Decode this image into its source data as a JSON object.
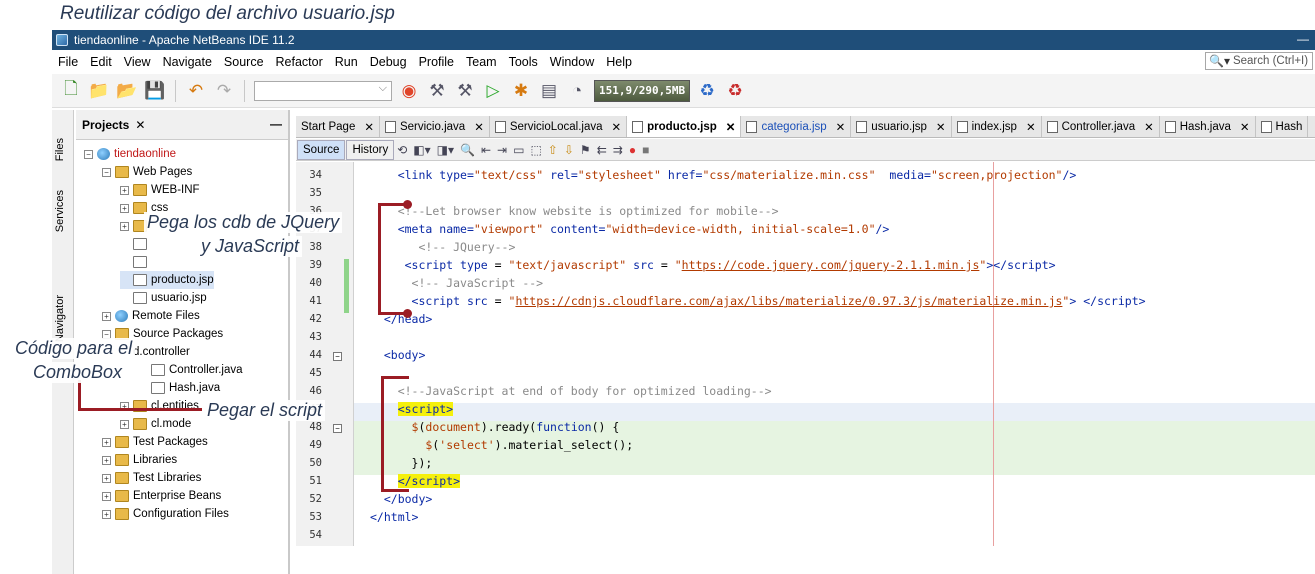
{
  "caption": "Reutilizar código del archivo usuario.jsp",
  "window": {
    "title": "tiendaonline - Apache NetBeans IDE 11.2"
  },
  "menu": [
    "File",
    "Edit",
    "View",
    "Navigate",
    "Source",
    "Refactor",
    "Run",
    "Debug",
    "Profile",
    "Team",
    "Tools",
    "Window",
    "Help"
  ],
  "search": {
    "placeholder": "Search (Ctrl+I)"
  },
  "toolbar": {
    "memory": "151,9/290,5MB"
  },
  "side_tabs": [
    "Files",
    "Services",
    "Navigator"
  ],
  "projects": {
    "title": "Projects",
    "tree": [
      {
        "label": "tiendaonline",
        "level": 0,
        "toggle": "−",
        "icon": "globe",
        "red": true
      },
      {
        "label": "Web Pages",
        "level": 1,
        "toggle": "−",
        "icon": "folder"
      },
      {
        "label": "WEB-INF",
        "level": 2,
        "toggle": "+",
        "icon": "folder"
      },
      {
        "label": "css",
        "level": 2,
        "toggle": "+",
        "icon": "folder"
      },
      {
        "label": "",
        "level": 2,
        "toggle": "+",
        "icon": "folder"
      },
      {
        "label": "",
        "level": 2,
        "toggle": "",
        "icon": "file"
      },
      {
        "label": "",
        "level": 2,
        "toggle": "",
        "icon": "file"
      },
      {
        "label": "producto.jsp",
        "level": 2,
        "toggle": "",
        "icon": "file",
        "selected": true
      },
      {
        "label": "usuario.jsp",
        "level": 2,
        "toggle": "",
        "icon": "file"
      },
      {
        "label": "Remote Files",
        "level": 1,
        "toggle": "+",
        "icon": "globe"
      },
      {
        "label": "Source Packages",
        "level": 1,
        "toggle": "−",
        "icon": "folder"
      },
      {
        "label": "d.controller",
        "level": 2,
        "toggle": "",
        "icon": ""
      },
      {
        "label": "Controller.java",
        "level": 3,
        "toggle": "",
        "icon": "file"
      },
      {
        "label": "Hash.java",
        "level": 3,
        "toggle": "",
        "icon": "file"
      },
      {
        "label": "cl.entities",
        "level": 2,
        "toggle": "+",
        "icon": "folder"
      },
      {
        "label": "cl.mode",
        "level": 2,
        "toggle": "+",
        "icon": "folder"
      },
      {
        "label": "Test Packages",
        "level": 1,
        "toggle": "+",
        "icon": "folder"
      },
      {
        "label": "Libraries",
        "level": 1,
        "toggle": "+",
        "icon": "folder"
      },
      {
        "label": "Test Libraries",
        "level": 1,
        "toggle": "+",
        "icon": "folder"
      },
      {
        "label": "Enterprise Beans",
        "level": 1,
        "toggle": "+",
        "icon": "folder"
      },
      {
        "label": "Configuration Files",
        "level": 1,
        "toggle": "+",
        "icon": "folder"
      }
    ]
  },
  "editor_tabs": [
    {
      "label": "Start Page",
      "icon": false
    },
    {
      "label": "Servicio.java",
      "icon": true
    },
    {
      "label": "ServicioLocal.java",
      "icon": true
    },
    {
      "label": "producto.jsp",
      "icon": true,
      "active": true
    },
    {
      "label": "categoria.jsp",
      "icon": true,
      "blue": true
    },
    {
      "label": "usuario.jsp",
      "icon": true
    },
    {
      "label": "index.jsp",
      "icon": true
    },
    {
      "label": "Controller.java",
      "icon": true
    },
    {
      "label": "Hash.java",
      "icon": true
    },
    {
      "label": "Hash",
      "icon": true,
      "noclose": true
    }
  ],
  "editor_toolbar": {
    "source": "Source",
    "history": "History"
  },
  "code_lines": [
    {
      "n": "34",
      "html": "    <span class='tag'>&lt;link</span> <span class='attr'>type=</span><span class='str'>\"text/css\"</span> <span class='attr'>rel=</span><span class='str'>\"stylesheet\"</span> <span class='attr'>href=</span><span class='str'>\"css/materialize.min.css\"</span>  <span class='attr'>media=</span><span class='str'>\"screen,projection\"</span><span class='tag'>/&gt;</span>"
    },
    {
      "n": "35",
      "html": ""
    },
    {
      "n": "36",
      "html": "    <span class='cmt'>&lt;!--Let browser know website is optimized for mobile--&gt;</span>"
    },
    {
      "n": "37",
      "html": "    <span class='tag'>&lt;meta</span> <span class='attr'>name=</span><span class='str'>\"viewport\"</span> <span class='attr'>content=</span><span class='str'>\"width=device-width, initial-scale=1.0\"</span><span class='tag'>/&gt;</span>"
    },
    {
      "n": "38",
      "html": "       <span class='cmt'>&lt;!-- JQuery--&gt;</span>"
    },
    {
      "n": "39",
      "html": "     <span class='tag'>&lt;script</span> <span class='attr'>type</span> = <span class='str'>\"text/javascript\"</span> <span class='attr'>src</span> = <span class='str'>\"<span class='url'>https://code.jquery.com/jquery-2.1.1.min.js</span>\"</span><span class='tag'>&gt;&lt;/script&gt;</span>"
    },
    {
      "n": "40",
      "html": "      <span class='cmt'>&lt;!-- JavaScript --&gt;</span>"
    },
    {
      "n": "41",
      "html": "      <span class='tag'>&lt;script</span> <span class='attr'>src</span> = <span class='str'>\"<span class='url'>https://cdnjs.cloudflare.com/ajax/libs/materialize/0.97.3/js/materialize.min.js</span>\"</span><span class='tag'>&gt;</span> <span class='tag'>&lt;/script&gt;</span>"
    },
    {
      "n": "42",
      "html": "  <span class='tag'>&lt;/head&gt;</span>"
    },
    {
      "n": "43",
      "html": ""
    },
    {
      "n": "44",
      "html": "  <span class='tag'>&lt;body&gt;</span>"
    },
    {
      "n": "45",
      "html": ""
    },
    {
      "n": "46",
      "html": "    <span class='cmt'>&lt;!--JavaScript at end of body for optimized loading--&gt;</span>"
    },
    {
      "n": "47",
      "html": "    <span class='tag yel'>&lt;script&gt;</span>"
    },
    {
      "n": "48",
      "html": "      <span class='str'>$</span>(<span class='str'>document</span>).ready(<span class='kw'>function</span>() {"
    },
    {
      "n": "49",
      "html": "        <span class='str'>$</span>(<span class='str'>'select'</span>).material_select();"
    },
    {
      "n": "50",
      "html": "      });"
    },
    {
      "n": "51",
      "html": "    <span class='tag yel'>&lt;/script&gt;</span>"
    },
    {
      "n": "52",
      "html": "  <span class='tag'>&lt;/body&gt;</span>"
    },
    {
      "n": "53",
      "html": "<span class='tag'>&lt;/html&gt;</span>"
    },
    {
      "n": "54",
      "html": ""
    }
  ],
  "annotations": {
    "cdb": "Pega los cdb de JQuery",
    "cdb2": "y JavaScript",
    "combo1": "Código para el",
    "combo2": "ComboBox",
    "script": "Pegar el script"
  }
}
